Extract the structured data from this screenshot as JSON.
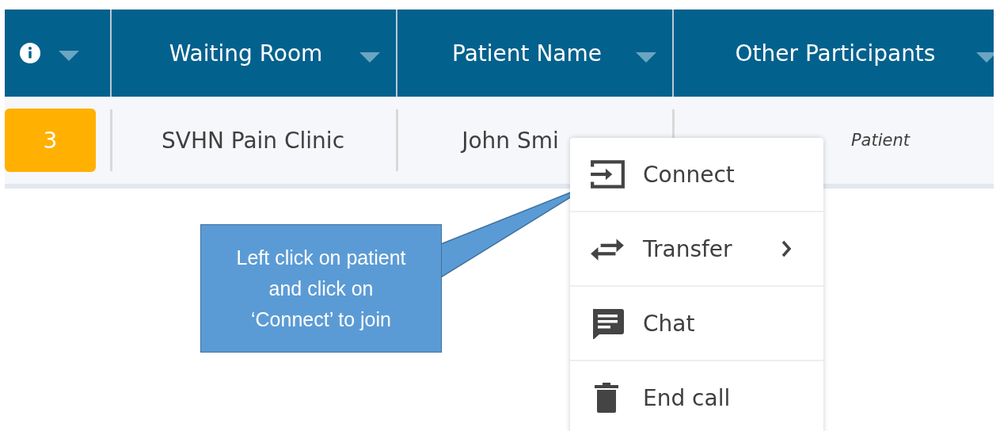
{
  "table": {
    "columns": [
      {
        "kind": "info"
      },
      {
        "kind": "text",
        "label": "Waiting Room"
      },
      {
        "kind": "text",
        "label": "Patient Name"
      },
      {
        "kind": "text",
        "label": "Other Participants"
      }
    ],
    "rows": [
      {
        "cells": [
          {
            "kind": "badge",
            "text": "3",
            "color": "#ffb000"
          },
          {
            "kind": "plain",
            "text": "SVHN Pain Clinic"
          },
          {
            "kind": "plain",
            "text": "John Smi"
          },
          {
            "kind": "note",
            "text": "Patient"
          }
        ]
      }
    ]
  },
  "context_menu": {
    "items": [
      {
        "kind": "connect",
        "label": "Connect",
        "submenu": false
      },
      {
        "kind": "transfer",
        "label": "Transfer",
        "submenu": true
      },
      {
        "kind": "chat",
        "label": "Chat",
        "submenu": false
      },
      {
        "kind": "end",
        "label": "End call",
        "submenu": false
      }
    ]
  },
  "callout": {
    "text": "Left click on patient\nand click on\n‘Connect’ to join"
  }
}
